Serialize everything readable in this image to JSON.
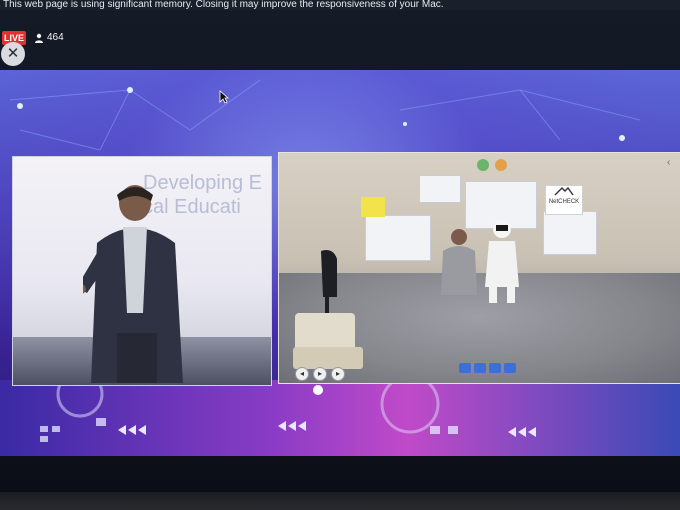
{
  "browser": {
    "memory_warning": "This web page is using significant memory. Closing it may improve the responsiveness of your Mac."
  },
  "stream": {
    "live_label": "LIVE",
    "viewer_count": "464",
    "close_symbol": "✕"
  },
  "presentation": {
    "slide_title_line1": "Developing E",
    "slide_title_line2": "cal Educati"
  },
  "vr_scene": {
    "control_labels": [
      "◂",
      "▸",
      "▸"
    ],
    "logo_label": "NetCHECK"
  },
  "colors": {
    "live_red": "#e03131",
    "stage_purple": "#4a3fb6",
    "vr_tool_blue": "#3d6fd8"
  },
  "icons": {
    "viewer": "person-icon",
    "close": "close-icon",
    "cursor": "mouse-cursor-icon"
  }
}
